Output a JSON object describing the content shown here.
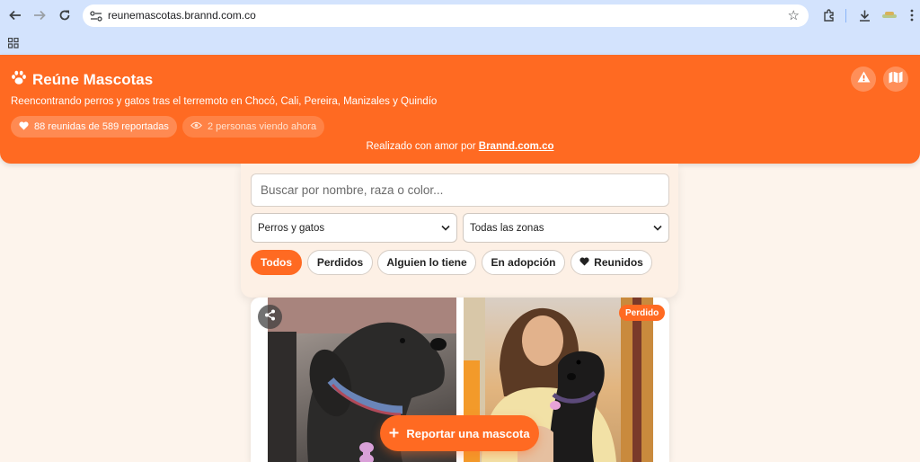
{
  "browser": {
    "url": "reunemascotas.brannd.com.co",
    "icons": [
      "back-icon",
      "forward-icon",
      "reload-icon",
      "site-info-icon",
      "star-icon",
      "extensions-icon",
      "download-icon",
      "profile-icon",
      "apps-icon"
    ]
  },
  "header": {
    "brand": "Reúne Mascotas",
    "subtitle": "Reencontrando perros y gatos tras el terremoto en Chocó, Cali, Pereira, Manizales y Quindío",
    "stats": "88 reunidas de 589 reportadas",
    "viewers": "2 personas viendo ahora",
    "credit_prefix": "Realizado con amor por",
    "credit_link": "Brannd.com.co"
  },
  "filters": {
    "search_placeholder": "Buscar por nombre, raza o color...",
    "species_selected": "Perros y gatos",
    "zone_selected": "Todas las zonas",
    "chips": [
      {
        "label": "Todos",
        "active": true
      },
      {
        "label": "Perdidos",
        "active": false
      },
      {
        "label": "Alguien lo tiene",
        "active": false
      },
      {
        "label": "En adopción",
        "active": false
      },
      {
        "label": "Reunidos",
        "active": false
      }
    ]
  },
  "card": {
    "badge": "Perdido"
  },
  "fab": {
    "label": "Reportar una mascota"
  },
  "colors": {
    "accent": "#ff6a22",
    "page_bg": "#fdf4ec",
    "chrome_bg": "#d3e3fd"
  }
}
